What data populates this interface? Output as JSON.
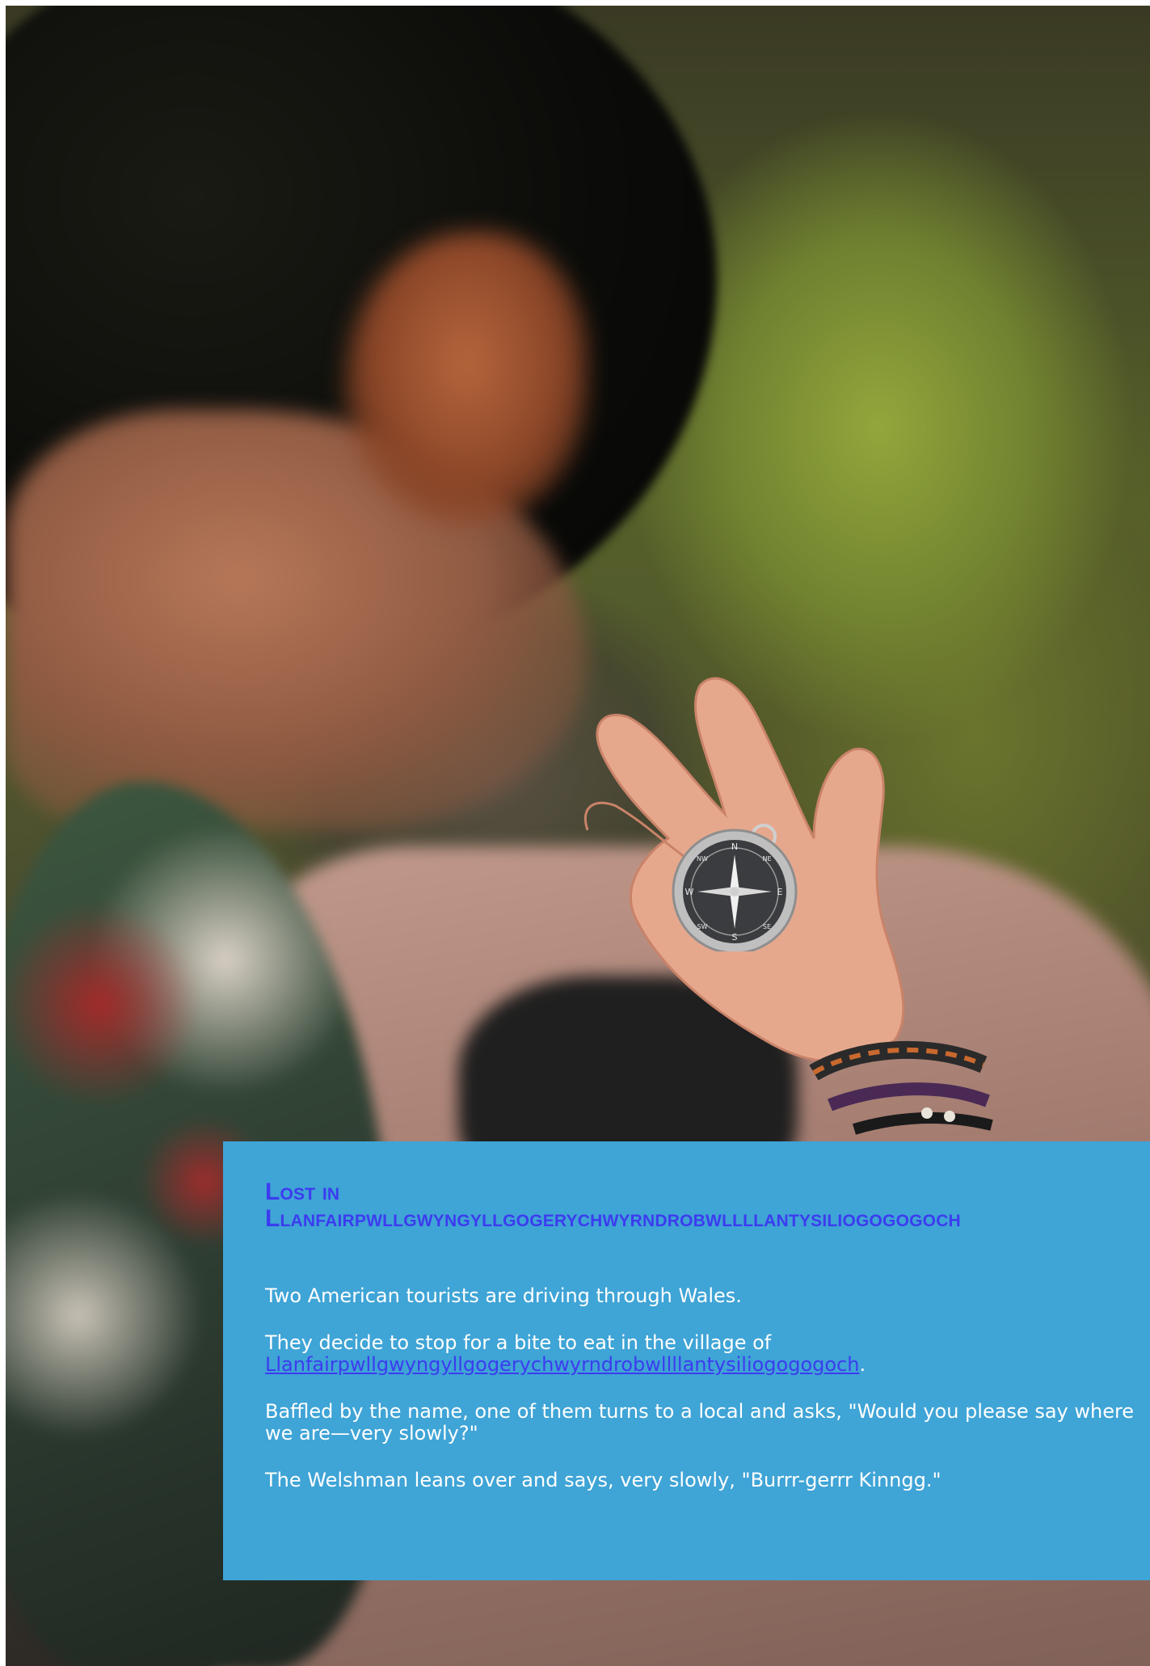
{
  "post": {
    "title_line1": "Lost in",
    "title_line2": "Llanfairpwllgwyngyllgogerychwyrndrobwllllantysiliogogogoch",
    "paragraphs": {
      "p1": "Two American tourists are driving through Wales.",
      "p2_prefix": "They decide to stop for a bite to eat in the village of ",
      "p2_link": "Llanfairpwllgwyngyllgogerychwyrndrobwllllantysiliogogogoch",
      "p2_suffix": ".",
      "p3": "Baffled by the name, one of them turns to a local and asks, \"Would you please say where we are—very slowly?\"",
      "p4": "The Welshman leans over and says, very slowly, \"Burrr-gerrr Kinngg.\""
    }
  },
  "colors": {
    "card_background": "#3fa4d6",
    "title_color": "#3c3cef",
    "link_color": "#3c3cef",
    "body_text": "#ffffff"
  },
  "compass": {
    "labels": [
      "N",
      "NE",
      "E",
      "SE",
      "S",
      "SW",
      "W",
      "NW"
    ]
  }
}
